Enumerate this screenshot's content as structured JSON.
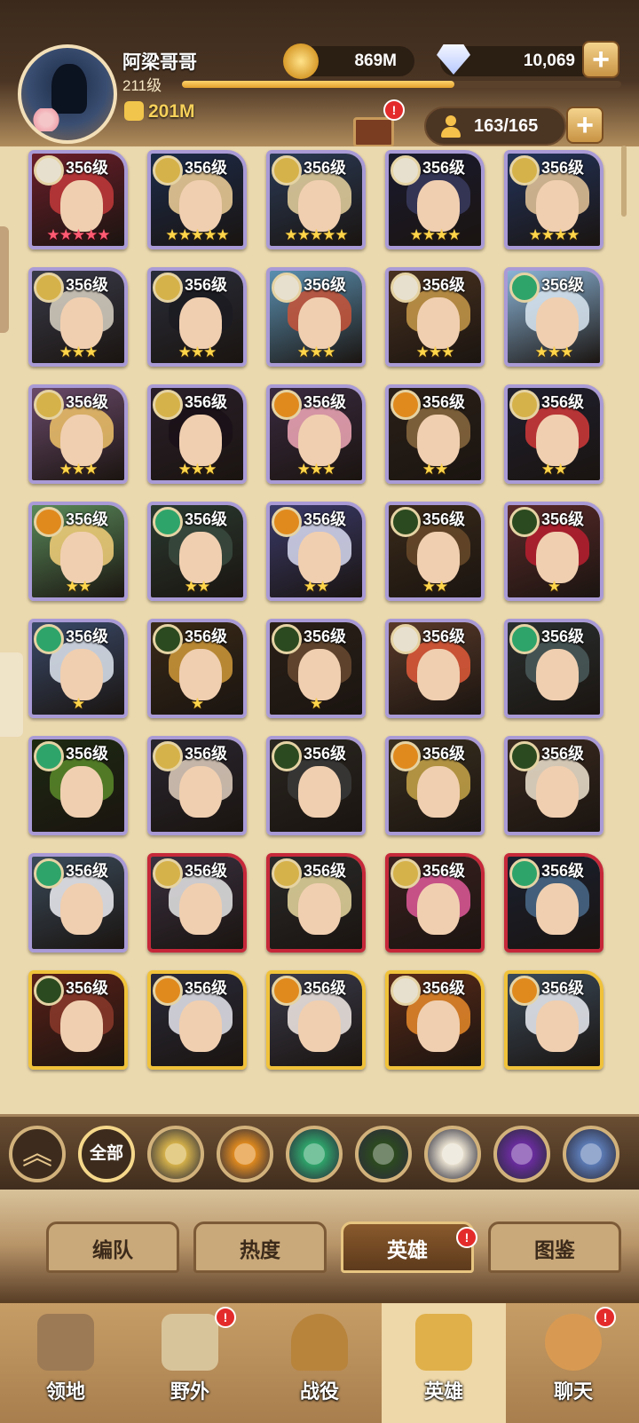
{
  "player": {
    "name": "阿梁哥哥",
    "level": "211级",
    "xp_progress": 0.62,
    "power": "201M"
  },
  "currency": {
    "gold": "869M",
    "diamonds": "10,069",
    "plus": "+"
  },
  "roster": {
    "count": "163/165",
    "plus": "+",
    "chest_badge": "!"
  },
  "heroes": [
    {
      "level": "356级",
      "stars": "★★★★★",
      "star_color": "red",
      "faction": "celestial",
      "frame": "purple"
    },
    {
      "level": "356级",
      "stars": "★★★★★",
      "star_color": "gold",
      "faction": "lightbearer",
      "frame": "purple"
    },
    {
      "level": "356级",
      "stars": "★★★★★",
      "star_color": "gold",
      "faction": "lightbearer",
      "frame": "purple"
    },
    {
      "level": "356级",
      "stars": "★★★★",
      "star_color": "gold",
      "faction": "celestial",
      "frame": "purple"
    },
    {
      "level": "356级",
      "stars": "★★★★",
      "star_color": "gold",
      "faction": "lightbearer",
      "frame": "purple"
    },
    {
      "level": "356级",
      "stars": "★★★",
      "star_color": "gold",
      "faction": "lightbearer",
      "frame": "purple"
    },
    {
      "level": "356级",
      "stars": "★★★",
      "star_color": "gold",
      "faction": "lightbearer",
      "frame": "purple"
    },
    {
      "level": "356级",
      "stars": "★★★",
      "star_color": "gold",
      "faction": "celestial",
      "frame": "purple"
    },
    {
      "level": "356级",
      "stars": "★★★",
      "star_color": "gold",
      "faction": "celestial",
      "frame": "purple"
    },
    {
      "level": "356级",
      "stars": "★★★",
      "star_color": "gold",
      "faction": "wilder",
      "frame": "purple"
    },
    {
      "level": "356级",
      "stars": "★★★",
      "star_color": "gold",
      "faction": "lightbearer",
      "frame": "purple"
    },
    {
      "level": "356级",
      "stars": "★★★",
      "star_color": "gold",
      "faction": "lightbearer",
      "frame": "purple"
    },
    {
      "level": "356级",
      "stars": "★★★",
      "star_color": "gold",
      "faction": "mauler",
      "frame": "purple"
    },
    {
      "level": "356级",
      "stars": "★★",
      "star_color": "gold",
      "faction": "mauler",
      "frame": "purple"
    },
    {
      "level": "356级",
      "stars": "★★",
      "star_color": "gold",
      "faction": "lightbearer",
      "frame": "purple"
    },
    {
      "level": "356级",
      "stars": "★★",
      "star_color": "gold",
      "faction": "mauler",
      "frame": "purple"
    },
    {
      "level": "356级",
      "stars": "★★",
      "star_color": "gold",
      "faction": "wilder",
      "frame": "purple"
    },
    {
      "level": "356级",
      "stars": "★★",
      "star_color": "gold",
      "faction": "mauler",
      "frame": "purple"
    },
    {
      "level": "356级",
      "stars": "★★",
      "star_color": "gold",
      "faction": "graveborn",
      "frame": "purple"
    },
    {
      "level": "356级",
      "stars": "★",
      "star_color": "gold",
      "faction": "graveborn",
      "frame": "purple"
    },
    {
      "level": "356级",
      "stars": "★",
      "star_color": "gold",
      "faction": "wilder",
      "frame": "purple"
    },
    {
      "level": "356级",
      "stars": "★",
      "star_color": "gold",
      "faction": "graveborn",
      "frame": "purple"
    },
    {
      "level": "356级",
      "stars": "★",
      "star_color": "gold",
      "faction": "graveborn",
      "frame": "purple"
    },
    {
      "level": "356级",
      "stars": "",
      "star_color": "gold",
      "faction": "celestial",
      "frame": "purple"
    },
    {
      "level": "356级",
      "stars": "",
      "star_color": "gold",
      "faction": "wilder",
      "frame": "purple"
    },
    {
      "level": "356级",
      "stars": "",
      "star_color": "gold",
      "faction": "wilder",
      "frame": "purple"
    },
    {
      "level": "356级",
      "stars": "",
      "star_color": "gold",
      "faction": "lightbearer",
      "frame": "purple"
    },
    {
      "level": "356级",
      "stars": "",
      "star_color": "gold",
      "faction": "graveborn",
      "frame": "purple"
    },
    {
      "level": "356级",
      "stars": "",
      "star_color": "gold",
      "faction": "mauler",
      "frame": "purple"
    },
    {
      "level": "356级",
      "stars": "",
      "star_color": "gold",
      "faction": "graveborn",
      "frame": "purple"
    },
    {
      "level": "356级",
      "stars": "",
      "star_color": "gold",
      "faction": "wilder",
      "frame": "purple"
    },
    {
      "level": "356级",
      "stars": "",
      "star_color": "gold",
      "faction": "lightbearer",
      "frame": "red"
    },
    {
      "level": "356级",
      "stars": "",
      "star_color": "gold",
      "faction": "lightbearer",
      "frame": "red"
    },
    {
      "level": "356级",
      "stars": "",
      "star_color": "gold",
      "faction": "lightbearer",
      "frame": "red"
    },
    {
      "level": "356级",
      "stars": "",
      "star_color": "gold",
      "faction": "wilder",
      "frame": "red"
    },
    {
      "level": "356级",
      "stars": "",
      "star_color": "gold",
      "faction": "graveborn",
      "frame": "gold"
    },
    {
      "level": "356级",
      "stars": "",
      "star_color": "gold",
      "faction": "mauler",
      "frame": "gold"
    },
    {
      "level": "356级",
      "stars": "",
      "star_color": "gold",
      "faction": "mauler",
      "frame": "gold"
    },
    {
      "level": "356级",
      "stars": "",
      "star_color": "gold",
      "faction": "celestial",
      "frame": "gold"
    },
    {
      "level": "356级",
      "stars": "",
      "star_color": "gold",
      "faction": "mauler",
      "frame": "gold"
    }
  ],
  "filters": {
    "collapse_icon": "up-chevron-icon",
    "all_label": "全部",
    "factions": [
      "lightbearer",
      "mauler",
      "wilder",
      "graveborn",
      "celestial",
      "hypogean",
      "dimensional"
    ]
  },
  "tabs": [
    "编队",
    "热度",
    "英雄",
    "图鉴"
  ],
  "active_tab": "英雄",
  "tab_badge": "!",
  "nav": [
    {
      "label": "领地",
      "icon": "castle-icon",
      "badge": ""
    },
    {
      "label": "野外",
      "icon": "map-scroll-icon",
      "badge": "!"
    },
    {
      "label": "战役",
      "icon": "crossed-swords-icon",
      "badge": ""
    },
    {
      "label": "英雄",
      "icon": "hero-helmet-icon",
      "badge": ""
    },
    {
      "label": "聊天",
      "icon": "chat-bubble-icon",
      "badge": "!"
    }
  ],
  "active_nav": "英雄",
  "colors": {
    "lightbearer": "#d6b24a",
    "mauler": "#e08a1e",
    "wilder": "#2fa46a",
    "graveborn": "#2c4a1f",
    "celestial": "#e8e0cf",
    "hypogean": "#6a2c9e",
    "dimensional": "#5c7bb5"
  }
}
